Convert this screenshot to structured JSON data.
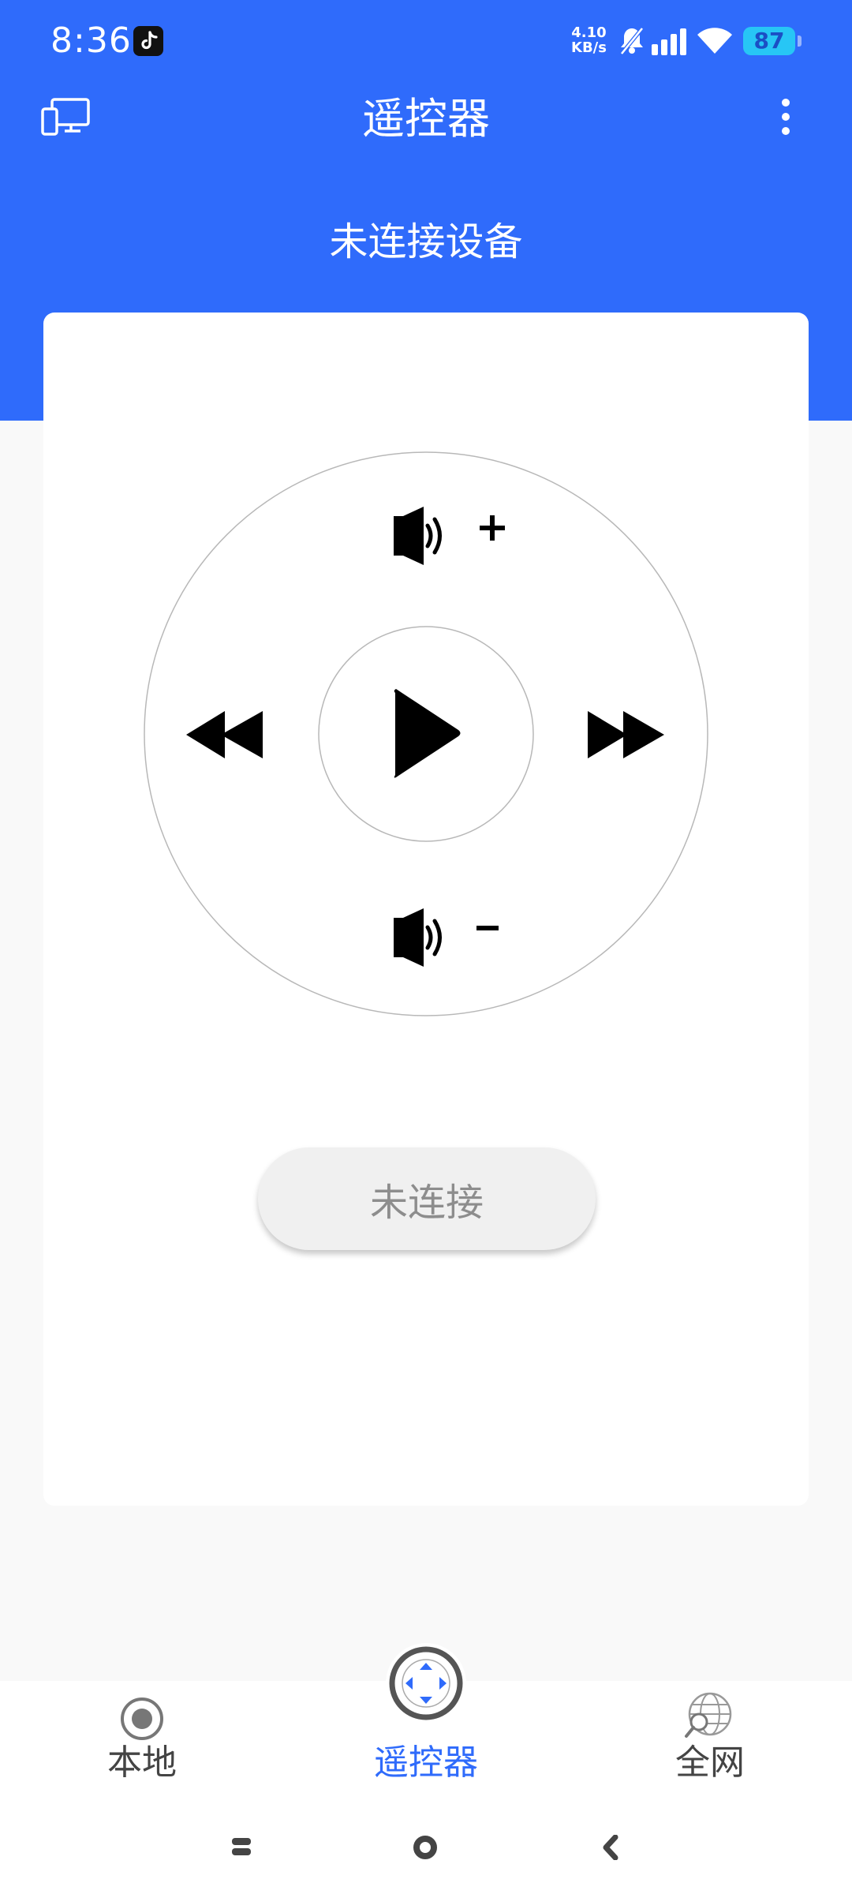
{
  "status_bar": {
    "time": "8:36",
    "net_speed_value": "4.10",
    "net_speed_unit": "KB/s",
    "battery": "87"
  },
  "app_bar": {
    "title": "遥控器"
  },
  "device_status": "未连接设备",
  "remote": {
    "connect_button_label": "未连接"
  },
  "bottom_nav": {
    "items": [
      {
        "label": "本地",
        "icon": "target-icon"
      },
      {
        "label": "遥控器",
        "icon": "remote-dpad-icon"
      },
      {
        "label": "全网",
        "icon": "globe-search-icon"
      }
    ],
    "active_index": 1
  },
  "colors": {
    "accent": "#2f6bfb",
    "background": "#f9f9f9",
    "card": "#ffffff",
    "button_bg": "#f0f0f0",
    "button_text": "#8d8d8d"
  }
}
